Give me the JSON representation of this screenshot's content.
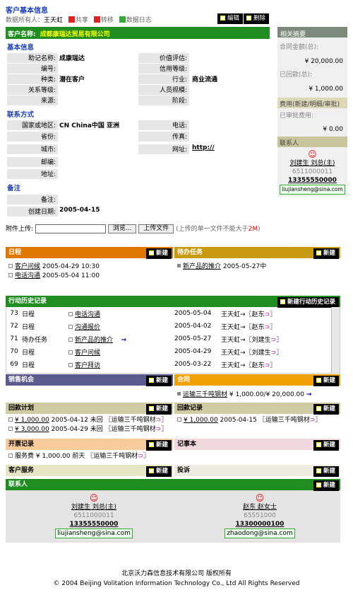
{
  "header": {
    "title": "客户基本信息",
    "owner_label": "数据所有人：",
    "owner_name": "王天虹",
    "share": "共享",
    "move": "转移",
    "log": "数据日志",
    "edit": "编辑",
    "delete": "删除"
  },
  "customer": {
    "name_label": "客户名称:",
    "name": "成都康瑞达贸易有限公司"
  },
  "basic": {
    "title": "基本信息",
    "mnemonic_label": "助记名称:",
    "mnemonic": "成康瑞达",
    "price_label": "价值评估:",
    "price": "",
    "code_label": "编号:",
    "code": "",
    "credit_label": "信用等级:",
    "credit": "",
    "type_label": "种类:",
    "type": "潜在客户",
    "industry_label": "行业:",
    "industry": "商业流通",
    "relation_label": "关系等级:",
    "relation": "",
    "staff_label": "人员规模:",
    "staff": "",
    "source_label": "来源:",
    "source": "",
    "stage_label": "阶段:",
    "stage": ""
  },
  "contact": {
    "title": "联系方式",
    "country_label": "国家或地区:",
    "country": "CN China中国  亚洲",
    "phone_label": "电话:",
    "phone": "",
    "province_label": "省份:",
    "province": "",
    "fax_label": "传真:",
    "fax": "",
    "city_label": "城市:",
    "city": "",
    "web_label": "网址:",
    "web": "http://",
    "zip_label": "邮编:",
    "zip": "",
    "addr_label": "地址:",
    "addr": ""
  },
  "remark": {
    "title": "备注",
    "remark_label": "备注:",
    "remark": "",
    "created_label": "创建日期:",
    "created": "2005-04-15"
  },
  "summary": {
    "title": "相关摘要",
    "contract_label": "合同金额(总):",
    "contract": "¥ 20,000.00",
    "paid_label": "已回款(总):",
    "paid": "¥ 1,000.00",
    "fee_label": "费用(新建/明细/审批)",
    "fee_approved_label": "已审批费用:",
    "fee_approved": "¥ 0.00",
    "contact_title": "联系人",
    "contact_name": "刘建生  刘总(主)",
    "contact_phone": "6511000011",
    "contact_mobile": "13355550000",
    "contact_email": "liujiansheng@sina.com"
  },
  "upload": {
    "label": "附件上传:",
    "browse": "浏览...",
    "upload_btn": "上传文件",
    "hint": "(上传的单一文件不能大于",
    "limit": "2M",
    "hint_end": ")"
  },
  "new_label": "新建",
  "schedule": {
    "title": "日程",
    "items": [
      {
        "name": "客户问候",
        "time": "2005-04-29 10:30"
      },
      {
        "name": "电话沟通",
        "time": "2005-05-04 11:00"
      }
    ]
  },
  "tasks": {
    "title": "待办任务",
    "items": [
      {
        "name": "新产品的推介",
        "time": "2005-05-27中"
      }
    ]
  },
  "history": {
    "title": "行动历史记录",
    "new_label": "新建行动历史记录",
    "rows": [
      {
        "no": "73",
        "type": "日程",
        "subject": "电话沟通",
        "date": "2005-05-04",
        "from": "王天虹",
        "to": "赵东"
      },
      {
        "no": "72",
        "type": "日程",
        "subject": "沟通报价",
        "date": "2005-04-02",
        "from": "王天虹",
        "to": "赵东"
      },
      {
        "no": "71",
        "type": "待办任务",
        "subject": "新产品的推介",
        "date": "2005-05-27",
        "from": "王天虹",
        "to": "刘建生"
      },
      {
        "no": "70",
        "type": "日程",
        "subject": "客户问候",
        "date": "2005-04-29",
        "from": "王天虹",
        "to": "刘建生"
      },
      {
        "no": "69",
        "type": "日程",
        "subject": "客户拜访",
        "date": "2005-03-22",
        "from": "王天虹",
        "to": "赵东"
      }
    ]
  },
  "opportunity": {
    "title": "销售机会"
  },
  "contract": {
    "title": "合同",
    "items": [
      {
        "name": "运输三千吨钢材",
        "amount": "¥ 1,000.00/¥ 20,000.00"
      }
    ]
  },
  "payplan": {
    "title": "回款计划",
    "items": [
      {
        "amount": "¥ 1,000.00",
        "text": "2005-04-12 未回",
        "ref": "〖运输三千吨钢材"
      },
      {
        "amount": "¥ 3,000.00",
        "text": "2005-04-29 未回",
        "ref": "〖运输三千吨钢材"
      }
    ]
  },
  "payrecord": {
    "title": "回款记录",
    "items": [
      {
        "amount": "¥ 1,000.00",
        "text": "2005-04-15",
        "ref": "〖运输三千吨钢材"
      }
    ]
  },
  "invoice": {
    "title": "开票记录",
    "items": [
      {
        "text": "服务费 ¥ 1,000.00 前天",
        "ref": "〖运输三千吨钢材"
      }
    ]
  },
  "memo": {
    "title": "记事本"
  },
  "service": {
    "title": "客户服务"
  },
  "complaint": {
    "title": "投诉"
  },
  "contacts": {
    "title": "联系人",
    "people": [
      {
        "name": "刘建生  刘总(主)",
        "phone": "6511000011",
        "mobile": "13355550000",
        "email": "liujiansheng@sina.com"
      },
      {
        "name": "赵东  赵女士",
        "phone": "65551000",
        "mobile": "13300000100",
        "email": "zhaodong@sina.com"
      }
    ]
  },
  "footer": {
    "line1": "北京沃力森信息技术有限公司  版权所有",
    "line2": "© 2004   Beijing Volitation Information Technology Co., Ltd All Rights Reserved"
  }
}
